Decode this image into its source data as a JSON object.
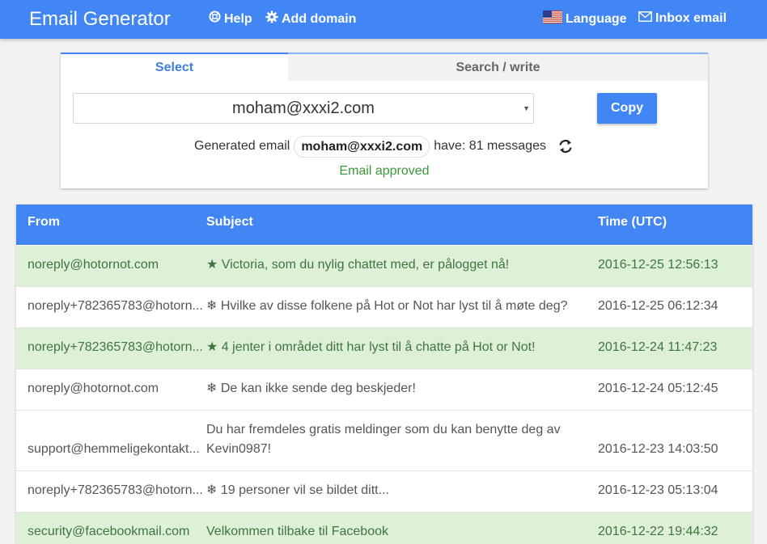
{
  "nav": {
    "brand": "Email Generator",
    "help": "Help",
    "add_domain": "Add domain",
    "language": "Language",
    "inbox": "Inbox email"
  },
  "tabs": {
    "select": "Select",
    "search": "Search / write"
  },
  "selector": {
    "current_email": "moham@xxxi2.com",
    "copy_label": "Copy"
  },
  "status": {
    "prefix": "Generated email",
    "email": "moham@xxxi2.com",
    "suffix": "have: 81 messages",
    "approved": "Email approved"
  },
  "table": {
    "headers": {
      "from": "From",
      "subject": "Subject",
      "time": "Time (UTC)"
    },
    "rows": [
      {
        "from": "noreply@hotornot.com",
        "subject": "★ Victoria, som du nylig chattet med, er pålogget nå!",
        "time": "2016-12-25 12:56:13",
        "highlight": true
      },
      {
        "from": "noreply+782365783@hotorn...",
        "subject": "❄ Hvilke av disse folkene på Hot or Not har lyst til å møte deg?",
        "time": "2016-12-25 06:12:34",
        "highlight": false
      },
      {
        "from": "noreply+782365783@hotorn...",
        "subject": "★ 4 jenter i området ditt har lyst til å chatte på Hot or Not!",
        "time": "2016-12-24 11:47:23",
        "highlight": true
      },
      {
        "from": "noreply@hotornot.com",
        "subject": "❄ De kan ikke sende deg beskjeder!",
        "time": "2016-12-24 05:12:45",
        "highlight": false
      },
      {
        "from": "support@hemmeligekontakt...",
        "subject": "Du har fremdeles gratis meldinger som du kan benytte deg av Kevin0987!",
        "time": "2016-12-23 14:03:50",
        "highlight": false
      },
      {
        "from": "noreply+782365783@hotorn...",
        "subject": "❄ 19 personer vil se bildet ditt...",
        "time": "2016-12-23 05:13:04",
        "highlight": false
      },
      {
        "from": "security@facebookmail.com",
        "subject": "Velkommen tilbake til Facebook",
        "time": "2016-12-22 19:44:32",
        "highlight": true
      }
    ]
  }
}
